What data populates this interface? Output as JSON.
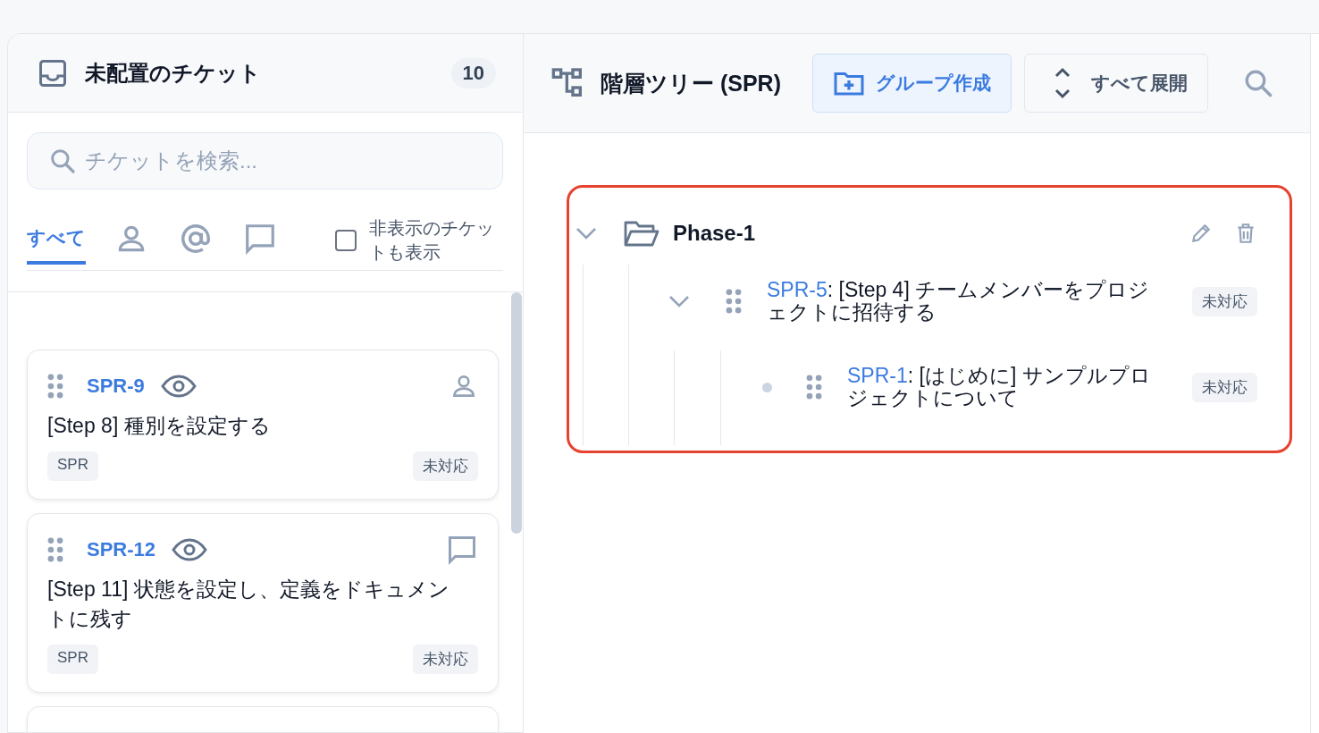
{
  "unplaced": {
    "title": "未配置のチケット",
    "count": "10"
  },
  "search": {
    "placeholder": "チケットを検索..."
  },
  "filter_tabs": [
    {
      "kind": "text",
      "label": "すべて",
      "selected": true
    },
    {
      "kind": "person",
      "selected": false
    },
    {
      "kind": "mention",
      "selected": false
    },
    {
      "kind": "comment",
      "selected": false
    }
  ],
  "show_hidden": {
    "label": "非表示のチケットも表示",
    "checked": false
  },
  "tickets": [
    {
      "id": "SPR-9",
      "watched": true,
      "kind": "assigned",
      "title": "[Step 8] 種別を設定する",
      "project": "SPR",
      "status": "未対応"
    },
    {
      "id": "SPR-12",
      "watched": true,
      "kind": "commented",
      "title": "[Step 11] 状態を設定し、定義をドキュメントに残す",
      "project": "SPR",
      "status": "未対応"
    }
  ],
  "tree_panel": {
    "title": "階層ツリー (SPR)",
    "buttons": [
      {
        "kind": "create-group",
        "label": "グループ作成"
      },
      {
        "kind": "expand-all",
        "label": "すべて展開"
      }
    ]
  },
  "tree": {
    "name": "Phase-1",
    "expanded": true,
    "highlighted": true,
    "children": [
      {
        "id": "SPR-5",
        "title": ": [Step 4] チームメンバーをプロジェクトに招待する",
        "status": "未対応",
        "expanded": true,
        "children": [
          {
            "id": "SPR-1",
            "title": ": [はじめに] サンプルプロジェクトについて",
            "status": "未対応"
          }
        ]
      }
    ]
  }
}
